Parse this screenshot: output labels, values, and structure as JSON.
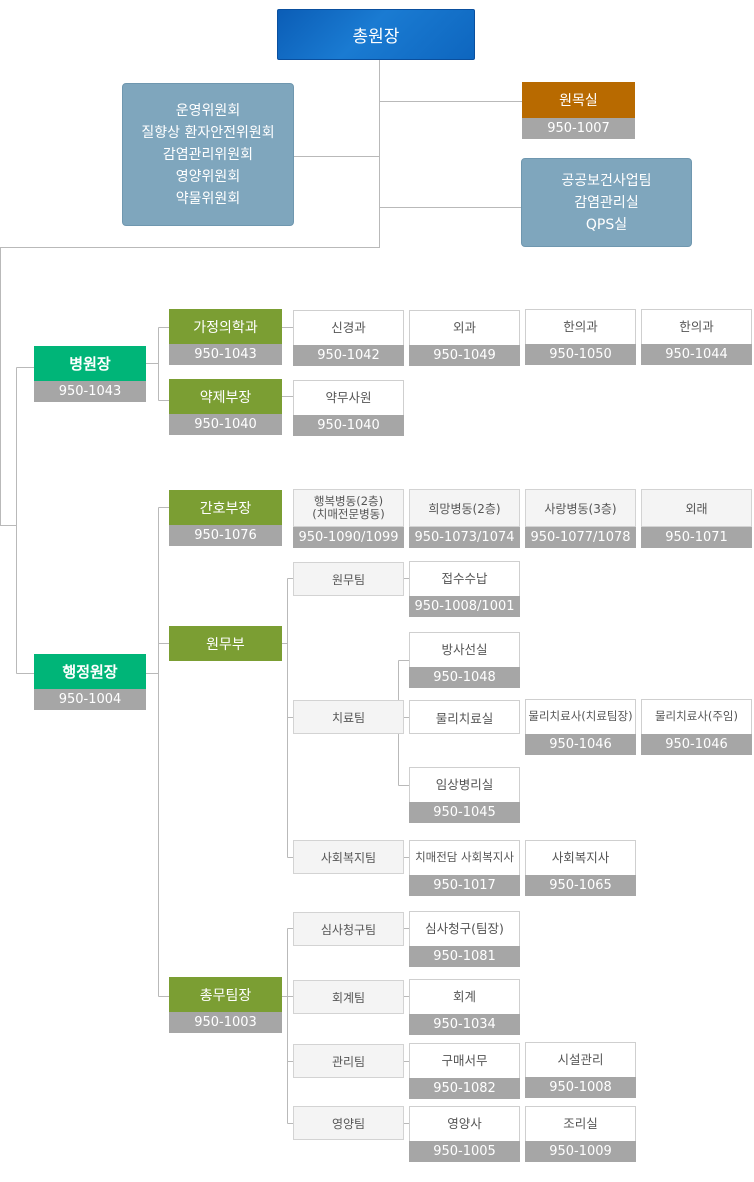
{
  "ceo": {
    "label": "총원장"
  },
  "committees": {
    "items": [
      "운영위원회",
      "질향상 환자안전위원회",
      "감염관리위원회",
      "영양위원회",
      "약물위원회"
    ]
  },
  "chaplain": {
    "label": "원목실",
    "phone": "950-1007"
  },
  "public_health": {
    "items": [
      "공공보건사업팀",
      "감염관리실",
      "QPS실"
    ]
  },
  "hospital_director": {
    "label": "병원장",
    "phone": "950-1043"
  },
  "admin_director": {
    "label": "행정원장",
    "phone": "950-1004"
  },
  "family_medicine": {
    "label": "가정의학과",
    "phone": "950-1043"
  },
  "pharmacy_head": {
    "label": "약제부장",
    "phone": "950-1040"
  },
  "nursing_head": {
    "label": "간호부장",
    "phone": "950-1076"
  },
  "admin_dept": {
    "label": "원무부"
  },
  "general_affairs": {
    "label": "총무팀장",
    "phone": "950-1003"
  },
  "medical_depts": [
    {
      "label": "신경과",
      "phone": "950-1042"
    },
    {
      "label": "외과",
      "phone": "950-1049"
    },
    {
      "label": "한의과",
      "phone": "950-1050"
    },
    {
      "label": "한의과",
      "phone": "950-1044"
    }
  ],
  "pharmacy_staff": {
    "label": "약무사원",
    "phone": "950-1040"
  },
  "wards": [
    {
      "label": "행복병동(2층)",
      "sub": "(치매전문병동)",
      "phone": "950-1090/1099"
    },
    {
      "label": "희망병동(2층)",
      "phone": "950-1073/1074"
    },
    {
      "label": "사랑병동(3층)",
      "phone": "950-1077/1078"
    },
    {
      "label": "외래",
      "phone": "950-1071"
    }
  ],
  "teams": {
    "admin_team": "원무팀",
    "therapy_team": "치료팀",
    "social_team": "사회복지팀",
    "claims_team": "심사청구팀",
    "accounting_team": "회계팀",
    "management_team": "관리팀",
    "nutrition_team": "영양팀"
  },
  "units": {
    "reception": {
      "label": "접수수납",
      "phone": "950-1008/1001"
    },
    "radiology": {
      "label": "방사선실",
      "phone": "950-1048"
    },
    "physio": {
      "label": "물리치료실"
    },
    "physio_lead": {
      "label": "물리치료사(치료팀장)",
      "phone": "950-1046"
    },
    "physio_chief": {
      "label": "물리치료사(주임)",
      "phone": "950-1046"
    },
    "clinical_lab": {
      "label": "임상병리실",
      "phone": "950-1045"
    },
    "dementia_sw": {
      "label": "치매전담 사회복지사",
      "phone": "950-1017"
    },
    "social_worker": {
      "label": "사회복지사",
      "phone": "950-1065"
    },
    "claims_lead": {
      "label": "심사청구(팀장)",
      "phone": "950-1081"
    },
    "accounting": {
      "label": "회계",
      "phone": "950-1034"
    },
    "purchasing": {
      "label": "구매서무",
      "phone": "950-1082"
    },
    "facilities": {
      "label": "시설관리",
      "phone": "950-1008"
    },
    "dietitian": {
      "label": "영양사",
      "phone": "950-1005"
    },
    "kitchen": {
      "label": "조리실",
      "phone": "950-1009"
    }
  },
  "colors": {
    "ceo": "#0e66bf",
    "green_top": "#00b578",
    "olive": "#7b9e33",
    "chaplain": "#b86a00",
    "steel_blue": "#7fa6bd",
    "phone_gray": "#a6a6a6"
  }
}
